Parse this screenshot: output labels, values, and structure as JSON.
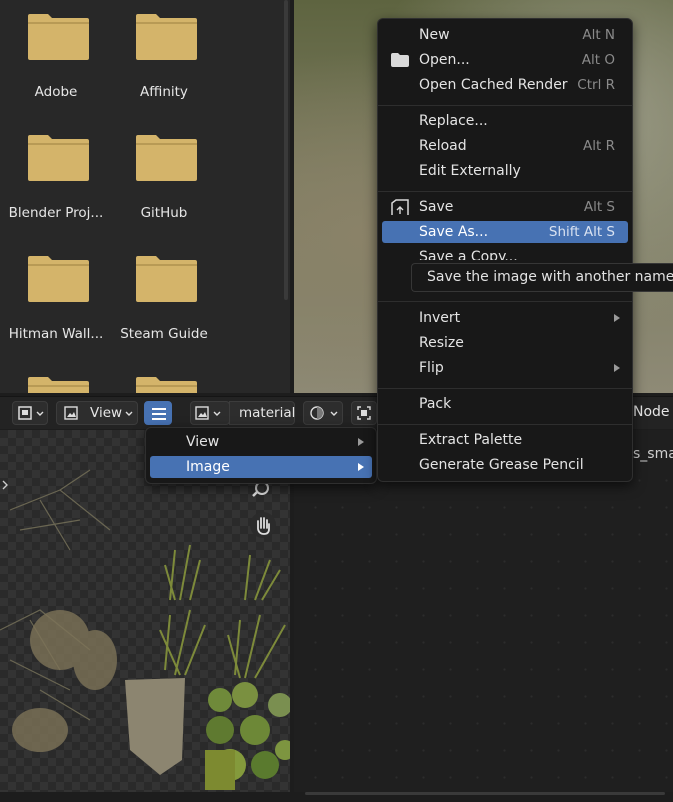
{
  "file_browser": {
    "folders": [
      "Adobe",
      "Affinity",
      "Blender Proj...",
      "GitHub",
      "Hitman Wall...",
      "Steam Guide",
      "",
      ""
    ]
  },
  "header": {
    "view_label": "View",
    "image_name": "material",
    "node_label": "Node",
    "node_subtext": "s_smal"
  },
  "view_submenu": {
    "items": [
      "View",
      "Image"
    ]
  },
  "image_menu": {
    "new": {
      "label": "New",
      "shortcut": "Alt N"
    },
    "open": {
      "label": "Open...",
      "shortcut": "Alt O"
    },
    "open_cached": {
      "label": "Open Cached Render",
      "shortcut": "Ctrl R"
    },
    "replace": {
      "label": "Replace...",
      "shortcut": ""
    },
    "reload": {
      "label": "Reload",
      "shortcut": "Alt R"
    },
    "edit_externally": {
      "label": "Edit Externally",
      "shortcut": ""
    },
    "save": {
      "label": "Save",
      "shortcut": "Alt S"
    },
    "save_as": {
      "label": "Save As...",
      "shortcut": "Shift Alt S"
    },
    "save_copy": {
      "label": "Save a Copy...",
      "shortcut": ""
    },
    "invert": {
      "label": "Invert",
      "shortcut": ""
    },
    "resize": {
      "label": "Resize",
      "shortcut": ""
    },
    "flip": {
      "label": "Flip",
      "shortcut": ""
    },
    "pack": {
      "label": "Pack",
      "shortcut": ""
    },
    "extract_palette": {
      "label": "Extract Palette",
      "shortcut": ""
    },
    "generate_grease_pencil": {
      "label": "Generate Grease Pencil",
      "shortcut": ""
    }
  },
  "tooltip": {
    "text": "Save the image with another name an"
  },
  "colors": {
    "highlight": "#4772b3",
    "folder": "#d4b46a",
    "menu_bg": "#181818"
  }
}
